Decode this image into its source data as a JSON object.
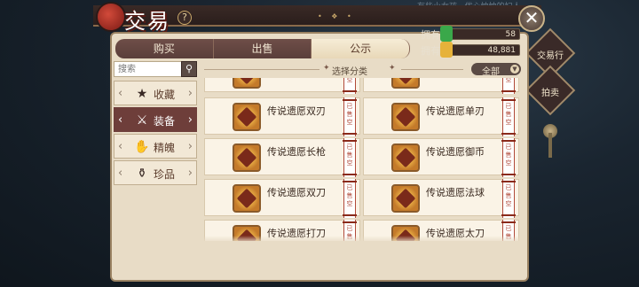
{
  "background_hint": "有些小女孩...优心忡忡的妇人",
  "header": {
    "title": "交易",
    "help": "?",
    "close": "✕"
  },
  "tabs": [
    {
      "label": "购买",
      "active": false
    },
    {
      "label": "出售",
      "active": false
    },
    {
      "label": "公示",
      "active": true
    }
  ],
  "currency": [
    {
      "label": "拥有",
      "value": "58",
      "color": "#3aa84a"
    },
    {
      "label": "拥有",
      "value": "48,881",
      "color": "#e6b23a"
    }
  ],
  "side_buttons": [
    {
      "label": "交易行"
    },
    {
      "label": "拍卖"
    }
  ],
  "search": {
    "placeholder": "搜索",
    "icon": "search-icon"
  },
  "categories": [
    {
      "label": "收藏",
      "icon": "star-icon",
      "glyph": "★",
      "active": false
    },
    {
      "label": "装备",
      "icon": "crossed-swords-icon",
      "glyph": "⚔",
      "active": true
    },
    {
      "label": "精魄",
      "icon": "claw-icon",
      "glyph": "✋",
      "active": false
    },
    {
      "label": "珍品",
      "icon": "pouch-icon",
      "glyph": "⚱",
      "active": false
    }
  ],
  "filter": {
    "label": "选择分类",
    "dropdown": "全部"
  },
  "sold_tag": "已售空",
  "items": [
    {
      "name": "",
      "partial": true
    },
    {
      "name": "",
      "partial": true
    },
    {
      "name": "传说遗愿双刃"
    },
    {
      "name": "传说遗愿单刃"
    },
    {
      "name": "传说遗愿长枪"
    },
    {
      "name": "传说遗愿御币"
    },
    {
      "name": "传说遗愿双刀"
    },
    {
      "name": "传说遗愿法球"
    },
    {
      "name": "传说遗愿打刀"
    },
    {
      "name": "传说遗愿太刀"
    }
  ]
}
